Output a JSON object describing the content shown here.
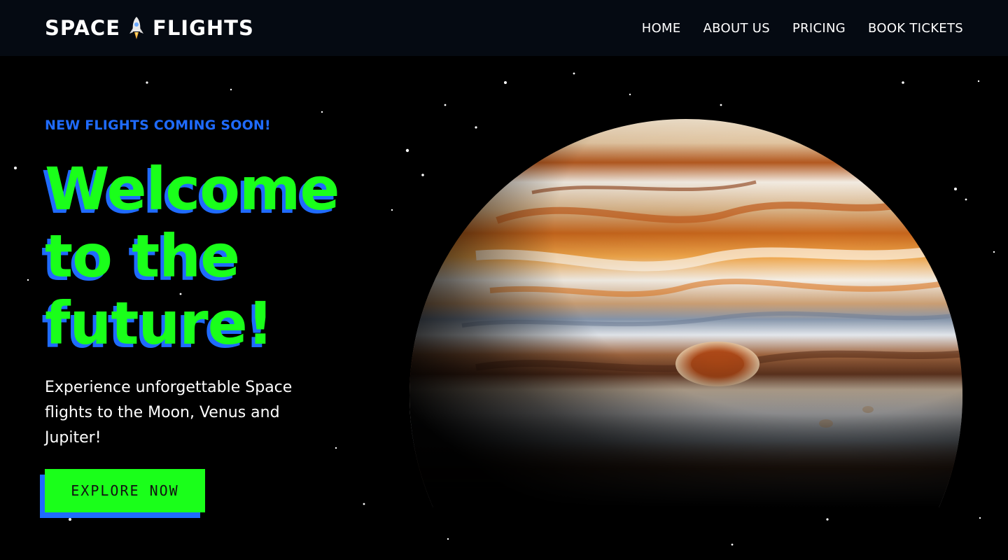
{
  "nav": {
    "logo_left": "SPACE",
    "logo_right": "FLIGHTS",
    "links": [
      "HOME",
      "ABOUT US",
      "PRICING",
      "BOOK TICKETS"
    ]
  },
  "hero": {
    "eyebrow": "NEW FLIGHTS COMING SOON!",
    "headline_lines": [
      "Welcome",
      "to the",
      "future!"
    ],
    "subtext": "Experience unforgettable Space flights to the Moon, Venus and Jupiter!",
    "cta_label": "EXPLORE NOW"
  },
  "colors": {
    "accent_green": "#1aff1a",
    "accent_blue": "#1f6bff",
    "background": "#000000",
    "navbar": "#050a12"
  },
  "icons": {
    "logo_icon": "rocket-icon",
    "planet": "jupiter-illustration"
  }
}
